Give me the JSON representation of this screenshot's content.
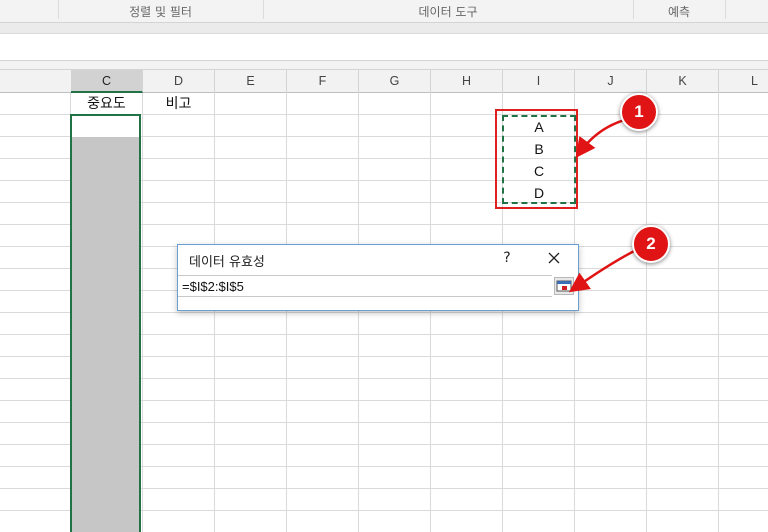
{
  "ribbon": {
    "groups": [
      "정렬 및 필터",
      "데이터 도구",
      "예측"
    ]
  },
  "columns": [
    "C",
    "D",
    "E",
    "F",
    "G",
    "H",
    "I",
    "J",
    "K",
    "L"
  ],
  "header_row": {
    "c1": "중요도",
    "d1": "비고"
  },
  "range_items": [
    "A",
    "B",
    "C",
    "D"
  ],
  "dialog": {
    "title": "데이터 유효성",
    "help": "?",
    "input_value": "=$I$2:$I$5"
  },
  "callouts": [
    "1",
    "2"
  ],
  "colors": {
    "selection_green": "#217346",
    "callout_red": "#e01414"
  }
}
